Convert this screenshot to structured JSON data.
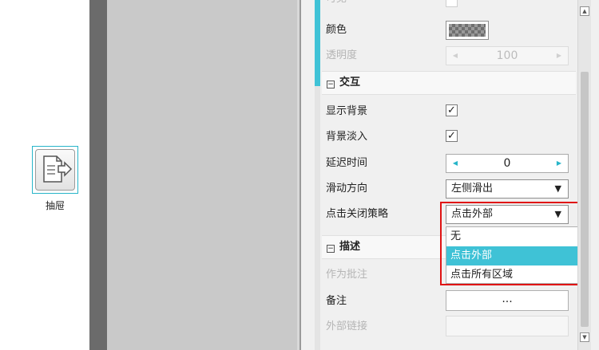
{
  "canvas": {
    "widget_label": "抽屉"
  },
  "panel": {
    "top_partial_label": "可见",
    "color_label": "颜色",
    "opacity_label": "透明度",
    "opacity_value": "100",
    "section_interaction": "交互",
    "show_background_label": "显示背景",
    "show_background_checked": "✓",
    "fade_background_label": "背景淡入",
    "fade_background_checked": "✓",
    "delay_label": "延迟时间",
    "delay_value": "0",
    "slide_direction_label": "滑动方向",
    "slide_direction_value": "左侧滑出",
    "click_close_label": "点击关闭策略",
    "click_close_value": "点击外部",
    "click_close_options": [
      "无",
      "点击外部",
      "点击所有区域"
    ],
    "section_description": "描述",
    "as_annotation_label": "作为批注",
    "note_label": "备注",
    "note_button": "...",
    "external_link_label": "外部链接",
    "collapse_symbol": "⊟"
  },
  "icons": {
    "caret_down": "▼",
    "arrow_left": "◀",
    "arrow_right": "▶",
    "scroll_up": "▲",
    "scroll_down": "▼"
  },
  "colors": {
    "accent": "#3fc2d6",
    "highlight_border": "#e01414"
  }
}
